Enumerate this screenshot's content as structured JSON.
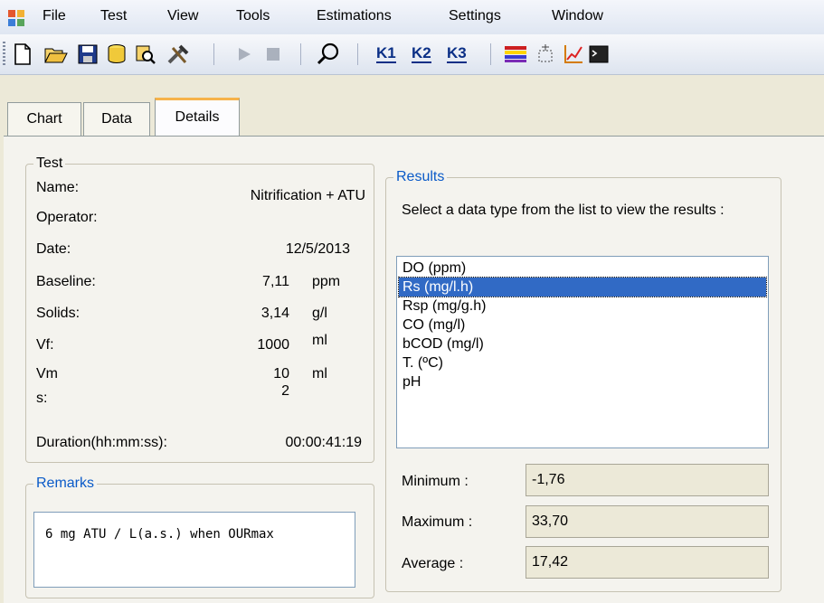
{
  "menu": {
    "items": [
      "File",
      "Test",
      "View",
      "Tools",
      "Estimations",
      "Settings",
      "Window"
    ]
  },
  "toolbar": {
    "icons": [
      "new-document-icon",
      "open-folder-icon",
      "save-disk-icon",
      "database-icon",
      "query-icon",
      "tools-icon",
      "play-icon",
      "stop-icon",
      "search-icon",
      "color-bars-icon",
      "selection-icon",
      "chart-icon",
      "console-icon"
    ],
    "k1": "K1",
    "k2": "K2",
    "k3": "K3"
  },
  "tabs": {
    "chart": "Chart",
    "data": "Data",
    "details": "Details",
    "active": "Details"
  },
  "test": {
    "legend": "Test",
    "name_label": "Name:",
    "name_value": "Nitrification + ATU",
    "operator_label": "Operator:",
    "date_label": "Date:",
    "date_value": "12/5/2013",
    "baseline_label": "Baseline:",
    "baseline_value": "7,11",
    "baseline_unit": "ppm",
    "solids_label": "Solids:",
    "solids_value": "3,14",
    "solids_unit": "g/l",
    "vf_label": "Vf:",
    "vf_value": "1000",
    "vf_unit": "ml",
    "vm_label": "Vm",
    "vm_value": "10",
    "vm_unit": "ml",
    "s_label": "s:",
    "s_value": "2",
    "duration_label": "Duration(hh:mm:ss):",
    "duration_value": "00:00:41:19"
  },
  "remarks": {
    "legend": "Remarks",
    "text": "6 mg ATU / L(a.s.) when OURmax"
  },
  "results": {
    "legend": "Results",
    "instruction": "Select a data type from the list to view the results :",
    "options": [
      "DO (ppm)",
      "Rs (mg/l.h)",
      "Rsp (mg/g.h)",
      "CO (mg/l)",
      "bCOD (mg/l)",
      "T. (ºC)",
      "pH"
    ],
    "selected": "Rs (mg/l.h)",
    "minimum_label": "Minimum :",
    "minimum_value": "-1,76",
    "maximum_label": "Maximum :",
    "maximum_value": "33,70",
    "average_label": "Average :",
    "average_value": "17,42"
  },
  "colors": {
    "accent_blue": "#0a5ac8",
    "selection": "#316ac5",
    "tab_highlight": "#f6b34a"
  }
}
